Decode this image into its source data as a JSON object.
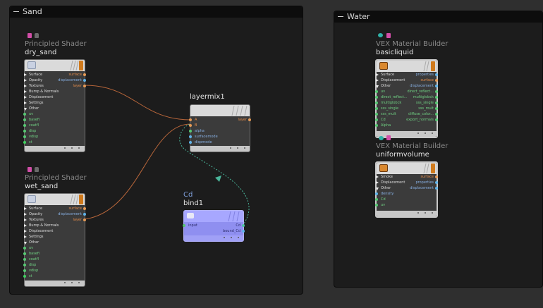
{
  "netboxes": {
    "sand": {
      "title": "Sand"
    },
    "water": {
      "title": "Water"
    }
  },
  "nodes": {
    "dry_sand": {
      "type": "Principled Shader",
      "name": "dry_sand",
      "inputs": [
        "Surface",
        "Opacity",
        "Textures",
        "Bump & Normals",
        "Displacement",
        "Settings",
        "Other",
        "uv",
        "basefi",
        "coatfl",
        "disp",
        "vdisp",
        "st"
      ],
      "outputs": [
        "surface",
        "displacement",
        "layer"
      ]
    },
    "wet_sand": {
      "type": "Principled Shader",
      "name": "wet_sand",
      "inputs": [
        "Surface",
        "Opacity",
        "Textures",
        "Bump & Normals",
        "Displacement",
        "Settings",
        "Other",
        "uv",
        "basefi",
        "coatfl",
        "disp",
        "vdisp",
        "st"
      ],
      "outputs": [
        "surface",
        "displacement",
        "layer"
      ]
    },
    "layermix1": {
      "name": "layermix1",
      "inputs": [
        "A",
        "B",
        "alpha",
        "surfacemode",
        "dispmode"
      ],
      "outputs": [
        "layer"
      ]
    },
    "bind1": {
      "type": "Cd",
      "name": "bind1",
      "inputs": [
        "input"
      ],
      "outputs": [
        "Cd",
        "bound_Cd"
      ]
    },
    "basicliquid": {
      "type": "VEX Material Builder",
      "name": "basicliquid",
      "inputs": [
        "Surface",
        "Displacement",
        "Other",
        "uv",
        "direct_reflect...",
        "multiglobck",
        "sss_single",
        "sss_mult",
        "Cd",
        "Alpha"
      ],
      "outputs": [
        "properties",
        "surface",
        "displacement",
        "direct_reflect...",
        "multiglobck",
        "sss_single",
        "sss_mult",
        "diffuse_color...",
        "export_normals"
      ]
    },
    "uniformvolume": {
      "type": "VEX Material Builder",
      "name": "uniformvolume",
      "inputs": [
        "Smoke",
        "Displacement",
        "Other",
        "density",
        "Cd",
        "uv"
      ],
      "outputs": [
        "surface",
        "properties",
        "displacement"
      ]
    }
  }
}
